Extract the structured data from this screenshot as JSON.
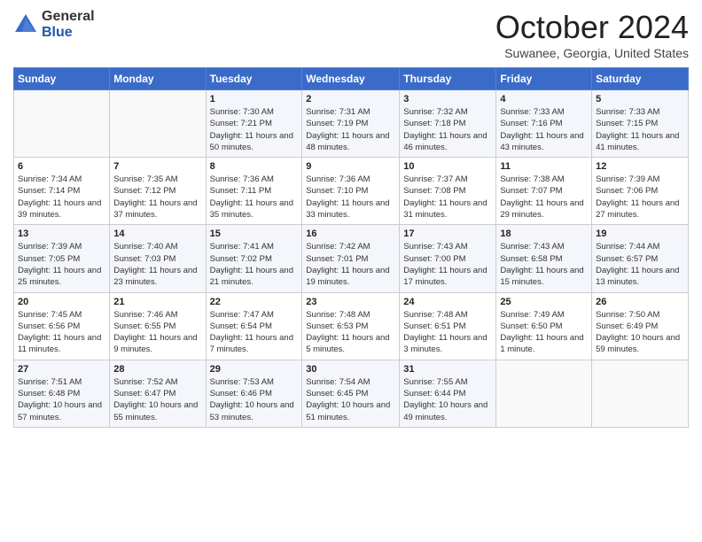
{
  "logo": {
    "general": "General",
    "blue": "Blue"
  },
  "header": {
    "month": "October 2024",
    "location": "Suwanee, Georgia, United States"
  },
  "days_of_week": [
    "Sunday",
    "Monday",
    "Tuesday",
    "Wednesday",
    "Thursday",
    "Friday",
    "Saturday"
  ],
  "weeks": [
    [
      {
        "day": "",
        "info": ""
      },
      {
        "day": "",
        "info": ""
      },
      {
        "day": "1",
        "info": "Sunrise: 7:30 AM\nSunset: 7:21 PM\nDaylight: 11 hours and 50 minutes."
      },
      {
        "day": "2",
        "info": "Sunrise: 7:31 AM\nSunset: 7:19 PM\nDaylight: 11 hours and 48 minutes."
      },
      {
        "day": "3",
        "info": "Sunrise: 7:32 AM\nSunset: 7:18 PM\nDaylight: 11 hours and 46 minutes."
      },
      {
        "day": "4",
        "info": "Sunrise: 7:33 AM\nSunset: 7:16 PM\nDaylight: 11 hours and 43 minutes."
      },
      {
        "day": "5",
        "info": "Sunrise: 7:33 AM\nSunset: 7:15 PM\nDaylight: 11 hours and 41 minutes."
      }
    ],
    [
      {
        "day": "6",
        "info": "Sunrise: 7:34 AM\nSunset: 7:14 PM\nDaylight: 11 hours and 39 minutes."
      },
      {
        "day": "7",
        "info": "Sunrise: 7:35 AM\nSunset: 7:12 PM\nDaylight: 11 hours and 37 minutes."
      },
      {
        "day": "8",
        "info": "Sunrise: 7:36 AM\nSunset: 7:11 PM\nDaylight: 11 hours and 35 minutes."
      },
      {
        "day": "9",
        "info": "Sunrise: 7:36 AM\nSunset: 7:10 PM\nDaylight: 11 hours and 33 minutes."
      },
      {
        "day": "10",
        "info": "Sunrise: 7:37 AM\nSunset: 7:08 PM\nDaylight: 11 hours and 31 minutes."
      },
      {
        "day": "11",
        "info": "Sunrise: 7:38 AM\nSunset: 7:07 PM\nDaylight: 11 hours and 29 minutes."
      },
      {
        "day": "12",
        "info": "Sunrise: 7:39 AM\nSunset: 7:06 PM\nDaylight: 11 hours and 27 minutes."
      }
    ],
    [
      {
        "day": "13",
        "info": "Sunrise: 7:39 AM\nSunset: 7:05 PM\nDaylight: 11 hours and 25 minutes."
      },
      {
        "day": "14",
        "info": "Sunrise: 7:40 AM\nSunset: 7:03 PM\nDaylight: 11 hours and 23 minutes."
      },
      {
        "day": "15",
        "info": "Sunrise: 7:41 AM\nSunset: 7:02 PM\nDaylight: 11 hours and 21 minutes."
      },
      {
        "day": "16",
        "info": "Sunrise: 7:42 AM\nSunset: 7:01 PM\nDaylight: 11 hours and 19 minutes."
      },
      {
        "day": "17",
        "info": "Sunrise: 7:43 AM\nSunset: 7:00 PM\nDaylight: 11 hours and 17 minutes."
      },
      {
        "day": "18",
        "info": "Sunrise: 7:43 AM\nSunset: 6:58 PM\nDaylight: 11 hours and 15 minutes."
      },
      {
        "day": "19",
        "info": "Sunrise: 7:44 AM\nSunset: 6:57 PM\nDaylight: 11 hours and 13 minutes."
      }
    ],
    [
      {
        "day": "20",
        "info": "Sunrise: 7:45 AM\nSunset: 6:56 PM\nDaylight: 11 hours and 11 minutes."
      },
      {
        "day": "21",
        "info": "Sunrise: 7:46 AM\nSunset: 6:55 PM\nDaylight: 11 hours and 9 minutes."
      },
      {
        "day": "22",
        "info": "Sunrise: 7:47 AM\nSunset: 6:54 PM\nDaylight: 11 hours and 7 minutes."
      },
      {
        "day": "23",
        "info": "Sunrise: 7:48 AM\nSunset: 6:53 PM\nDaylight: 11 hours and 5 minutes."
      },
      {
        "day": "24",
        "info": "Sunrise: 7:48 AM\nSunset: 6:51 PM\nDaylight: 11 hours and 3 minutes."
      },
      {
        "day": "25",
        "info": "Sunrise: 7:49 AM\nSunset: 6:50 PM\nDaylight: 11 hours and 1 minute."
      },
      {
        "day": "26",
        "info": "Sunrise: 7:50 AM\nSunset: 6:49 PM\nDaylight: 10 hours and 59 minutes."
      }
    ],
    [
      {
        "day": "27",
        "info": "Sunrise: 7:51 AM\nSunset: 6:48 PM\nDaylight: 10 hours and 57 minutes."
      },
      {
        "day": "28",
        "info": "Sunrise: 7:52 AM\nSunset: 6:47 PM\nDaylight: 10 hours and 55 minutes."
      },
      {
        "day": "29",
        "info": "Sunrise: 7:53 AM\nSunset: 6:46 PM\nDaylight: 10 hours and 53 minutes."
      },
      {
        "day": "30",
        "info": "Sunrise: 7:54 AM\nSunset: 6:45 PM\nDaylight: 10 hours and 51 minutes."
      },
      {
        "day": "31",
        "info": "Sunrise: 7:55 AM\nSunset: 6:44 PM\nDaylight: 10 hours and 49 minutes."
      },
      {
        "day": "",
        "info": ""
      },
      {
        "day": "",
        "info": ""
      }
    ]
  ]
}
